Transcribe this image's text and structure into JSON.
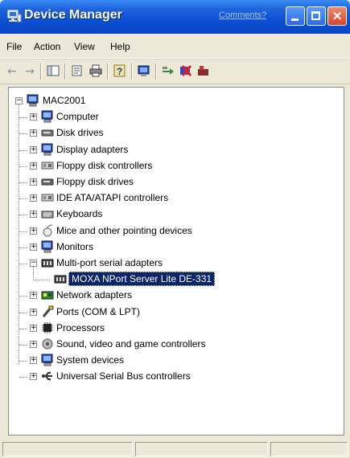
{
  "window": {
    "title": "Device Manager",
    "comments_link": "Comments?"
  },
  "menu": {
    "items": [
      "File",
      "Action",
      "View",
      "Help"
    ]
  },
  "toolbar": {
    "icons": [
      "back-arrow-icon",
      "forward-arrow-icon",
      "console-tree-icon",
      "properties-icon",
      "print-icon",
      "help-icon",
      "scan-hardware-icon",
      "update-driver-icon",
      "uninstall-icon",
      "disable-device-icon"
    ]
  },
  "tree": {
    "root": "MAC2001",
    "categories": [
      {
        "label": "Computer",
        "icon": "computer-icon",
        "color": "#2c4fc9"
      },
      {
        "label": "Disk drives",
        "icon": "disk-drive-icon",
        "color": "#777777"
      },
      {
        "label": "Display adapters",
        "icon": "display-adapter-icon",
        "color": "#2c4fc9"
      },
      {
        "label": "Floppy disk controllers",
        "icon": "floppy-controller-icon",
        "color": "#888888"
      },
      {
        "label": "Floppy disk drives",
        "icon": "floppy-drive-icon",
        "color": "#666666"
      },
      {
        "label": "IDE ATA/ATAPI controllers",
        "icon": "ide-controller-icon",
        "color": "#888888"
      },
      {
        "label": "Keyboards",
        "icon": "keyboard-icon",
        "color": "#666666"
      },
      {
        "label": "Mice and other pointing devices",
        "icon": "mouse-icon",
        "color": "#999999"
      },
      {
        "label": "Monitors",
        "icon": "monitor-icon",
        "color": "#2c4fc9"
      },
      {
        "label": "Multi-port serial adapters",
        "icon": "serial-adapter-icon",
        "color": "#555555",
        "expanded": true,
        "children": [
          {
            "label": "MOXA NPort Server Lite DE-331",
            "icon": "serial-adapter-icon",
            "selected": true
          }
        ]
      },
      {
        "label": "Network adapters",
        "icon": "network-adapter-icon",
        "color": "#2e8a2e"
      },
      {
        "label": "Ports (COM & LPT)",
        "icon": "ports-icon",
        "color": "#777777"
      },
      {
        "label": "Processors",
        "icon": "processor-icon",
        "color": "#333333"
      },
      {
        "label": "Sound, video and game controllers",
        "icon": "sound-icon",
        "color": "#777777"
      },
      {
        "label": "System devices",
        "icon": "system-devices-icon",
        "color": "#2c4fc9"
      },
      {
        "label": "Universal Serial Bus controllers",
        "icon": "usb-icon",
        "color": "#555555"
      }
    ]
  },
  "colors": {
    "titlebar": "#0b4fd2",
    "selection": "#0a246a",
    "chrome": "#ece9d8"
  }
}
